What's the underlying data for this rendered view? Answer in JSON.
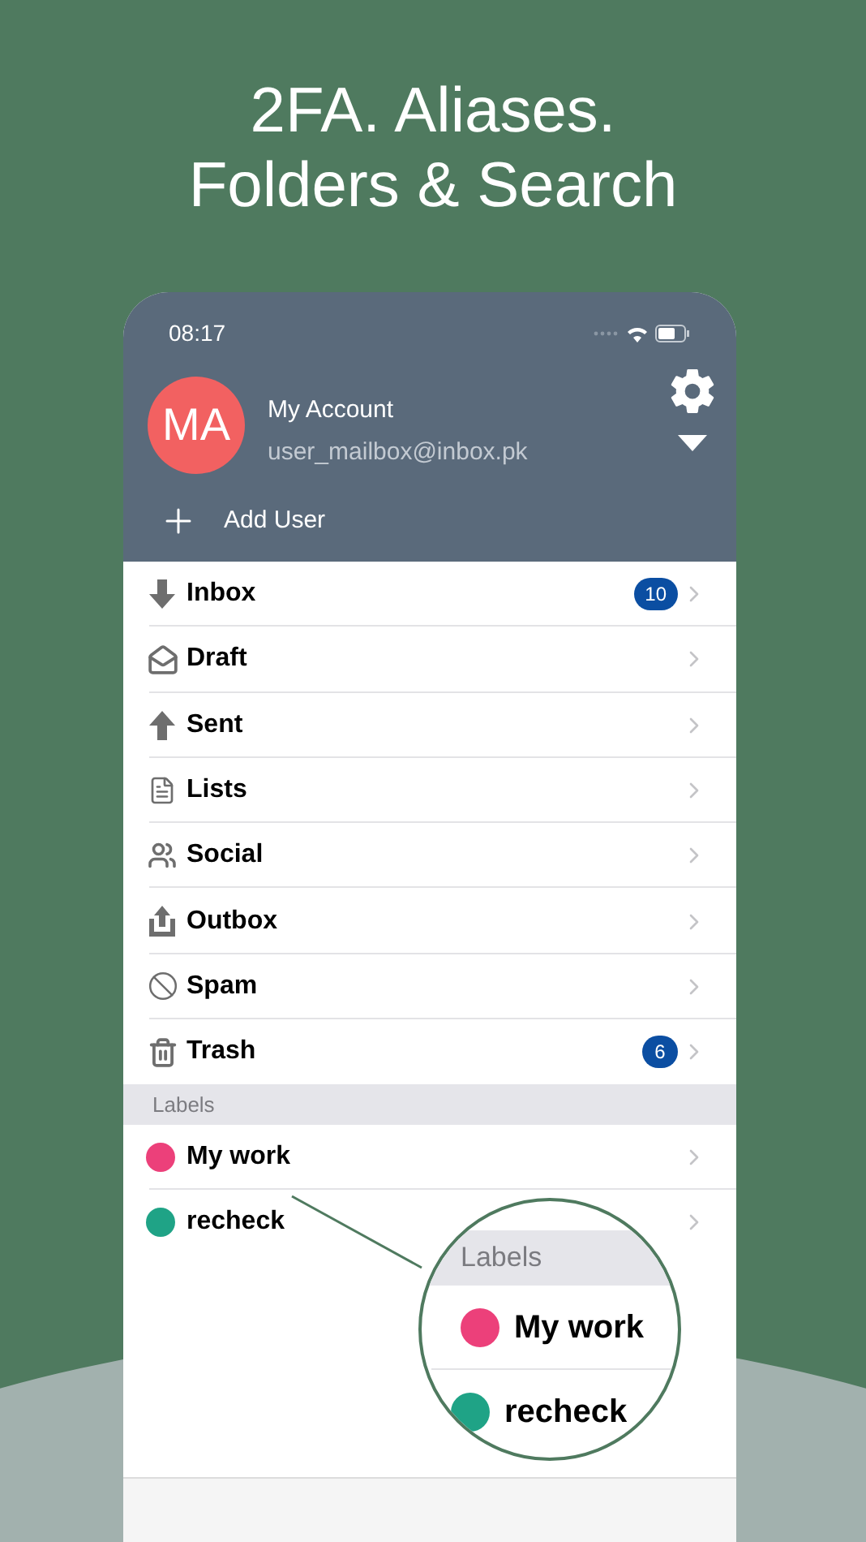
{
  "headline": [
    "2FA. Aliases.",
    "Folders & Search"
  ],
  "status_bar": {
    "time": "08:17"
  },
  "account": {
    "initials": "MA",
    "name": "My Account",
    "email": "user_mailbox@inbox.pk"
  },
  "add_user": "Add User",
  "folders": [
    {
      "kind": "inbox",
      "label": "Inbox",
      "badge": "10"
    },
    {
      "kind": "draft",
      "label": "Draft"
    },
    {
      "kind": "sent",
      "label": "Sent"
    },
    {
      "kind": "lists",
      "label": "Lists"
    },
    {
      "kind": "social",
      "label": "Social"
    },
    {
      "kind": "outbox",
      "label": "Outbox"
    },
    {
      "kind": "spam",
      "label": "Spam"
    },
    {
      "kind": "trash",
      "label": "Trash",
      "badge": "6"
    }
  ],
  "labels_header": "Labels",
  "labels": [
    {
      "label": "My work",
      "color": "#ec407a"
    },
    {
      "label": "recheck",
      "color": "#1fa386"
    }
  ],
  "magnifier": {
    "header": "Labels",
    "labels": [
      {
        "label": "My work",
        "color": "#ec407a"
      },
      {
        "label": "recheck",
        "color": "#1fa386"
      }
    ]
  }
}
